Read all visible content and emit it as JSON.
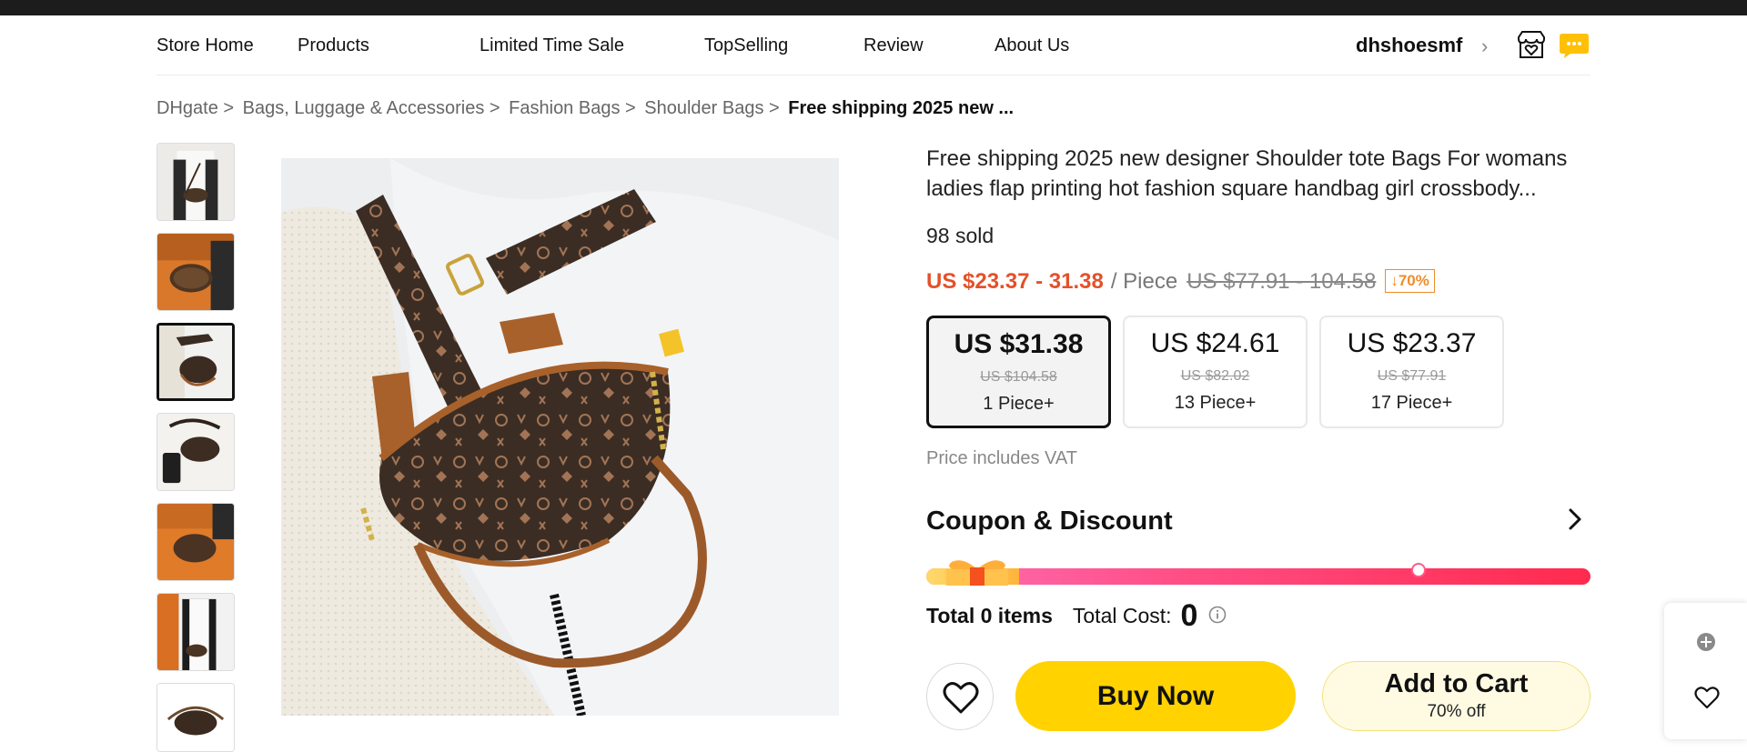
{
  "nav": {
    "items": [
      "Store Home",
      "Products",
      "Limited Time Sale",
      "TopSelling",
      "Review",
      "About Us"
    ],
    "store_name": "dhshoesmf"
  },
  "breadcrumb": {
    "items": [
      "DHgate >",
      "Bags, Luggage & Accessories >",
      "Fashion Bags >",
      "Shoulder Bags >"
    ],
    "current": "Free shipping 2025 new ..."
  },
  "gallery": {
    "thumbnail_count": 7,
    "active_index": 2
  },
  "product": {
    "title": "Free shipping 2025 new designer Shoulder tote Bags For womans ladies flap printing hot fashion square handbag girl crossbody...",
    "sold": "98 sold",
    "price_range": "US $23.37 - 31.38",
    "unit": "/ Piece",
    "original_range": "US $77.91 - 104.58",
    "discount_badge": "↓70%"
  },
  "tiers": [
    {
      "price": "US $31.38",
      "original": "US $104.58",
      "qty": "1 Piece+",
      "selected": true
    },
    {
      "price": "US $24.61",
      "original": "US $82.02",
      "qty": "13 Piece+",
      "selected": false
    },
    {
      "price": "US $23.37",
      "original": "US $77.91",
      "qty": "17 Piece+",
      "selected": false
    }
  ],
  "vat_note": "Price includes VAT",
  "coupon": {
    "title": "Coupon & Discount",
    "progress_fraction": 0.14
  },
  "totals": {
    "items_label": "Total 0 items",
    "cost_label": "Total Cost:",
    "cost_value": "0"
  },
  "actions": {
    "buy_label": "Buy Now",
    "cart_label": "Add to Cart",
    "cart_sub": "70% off"
  },
  "icons": {
    "store": "store-heart-icon",
    "message": "message-icon",
    "wishlist": "heart-icon",
    "info": "info-icon",
    "chevron": "chevron-right-icon",
    "add": "plus-circle-icon"
  },
  "colors": {
    "accent_price": "#e3512a",
    "badge": "#f08c2a",
    "buy_button": "#ffd200",
    "cart_button_bg": "#fffbe3",
    "message_icon": "#ffc107",
    "progress_start": "#ff6db3",
    "progress_end": "#ff2a4e"
  }
}
